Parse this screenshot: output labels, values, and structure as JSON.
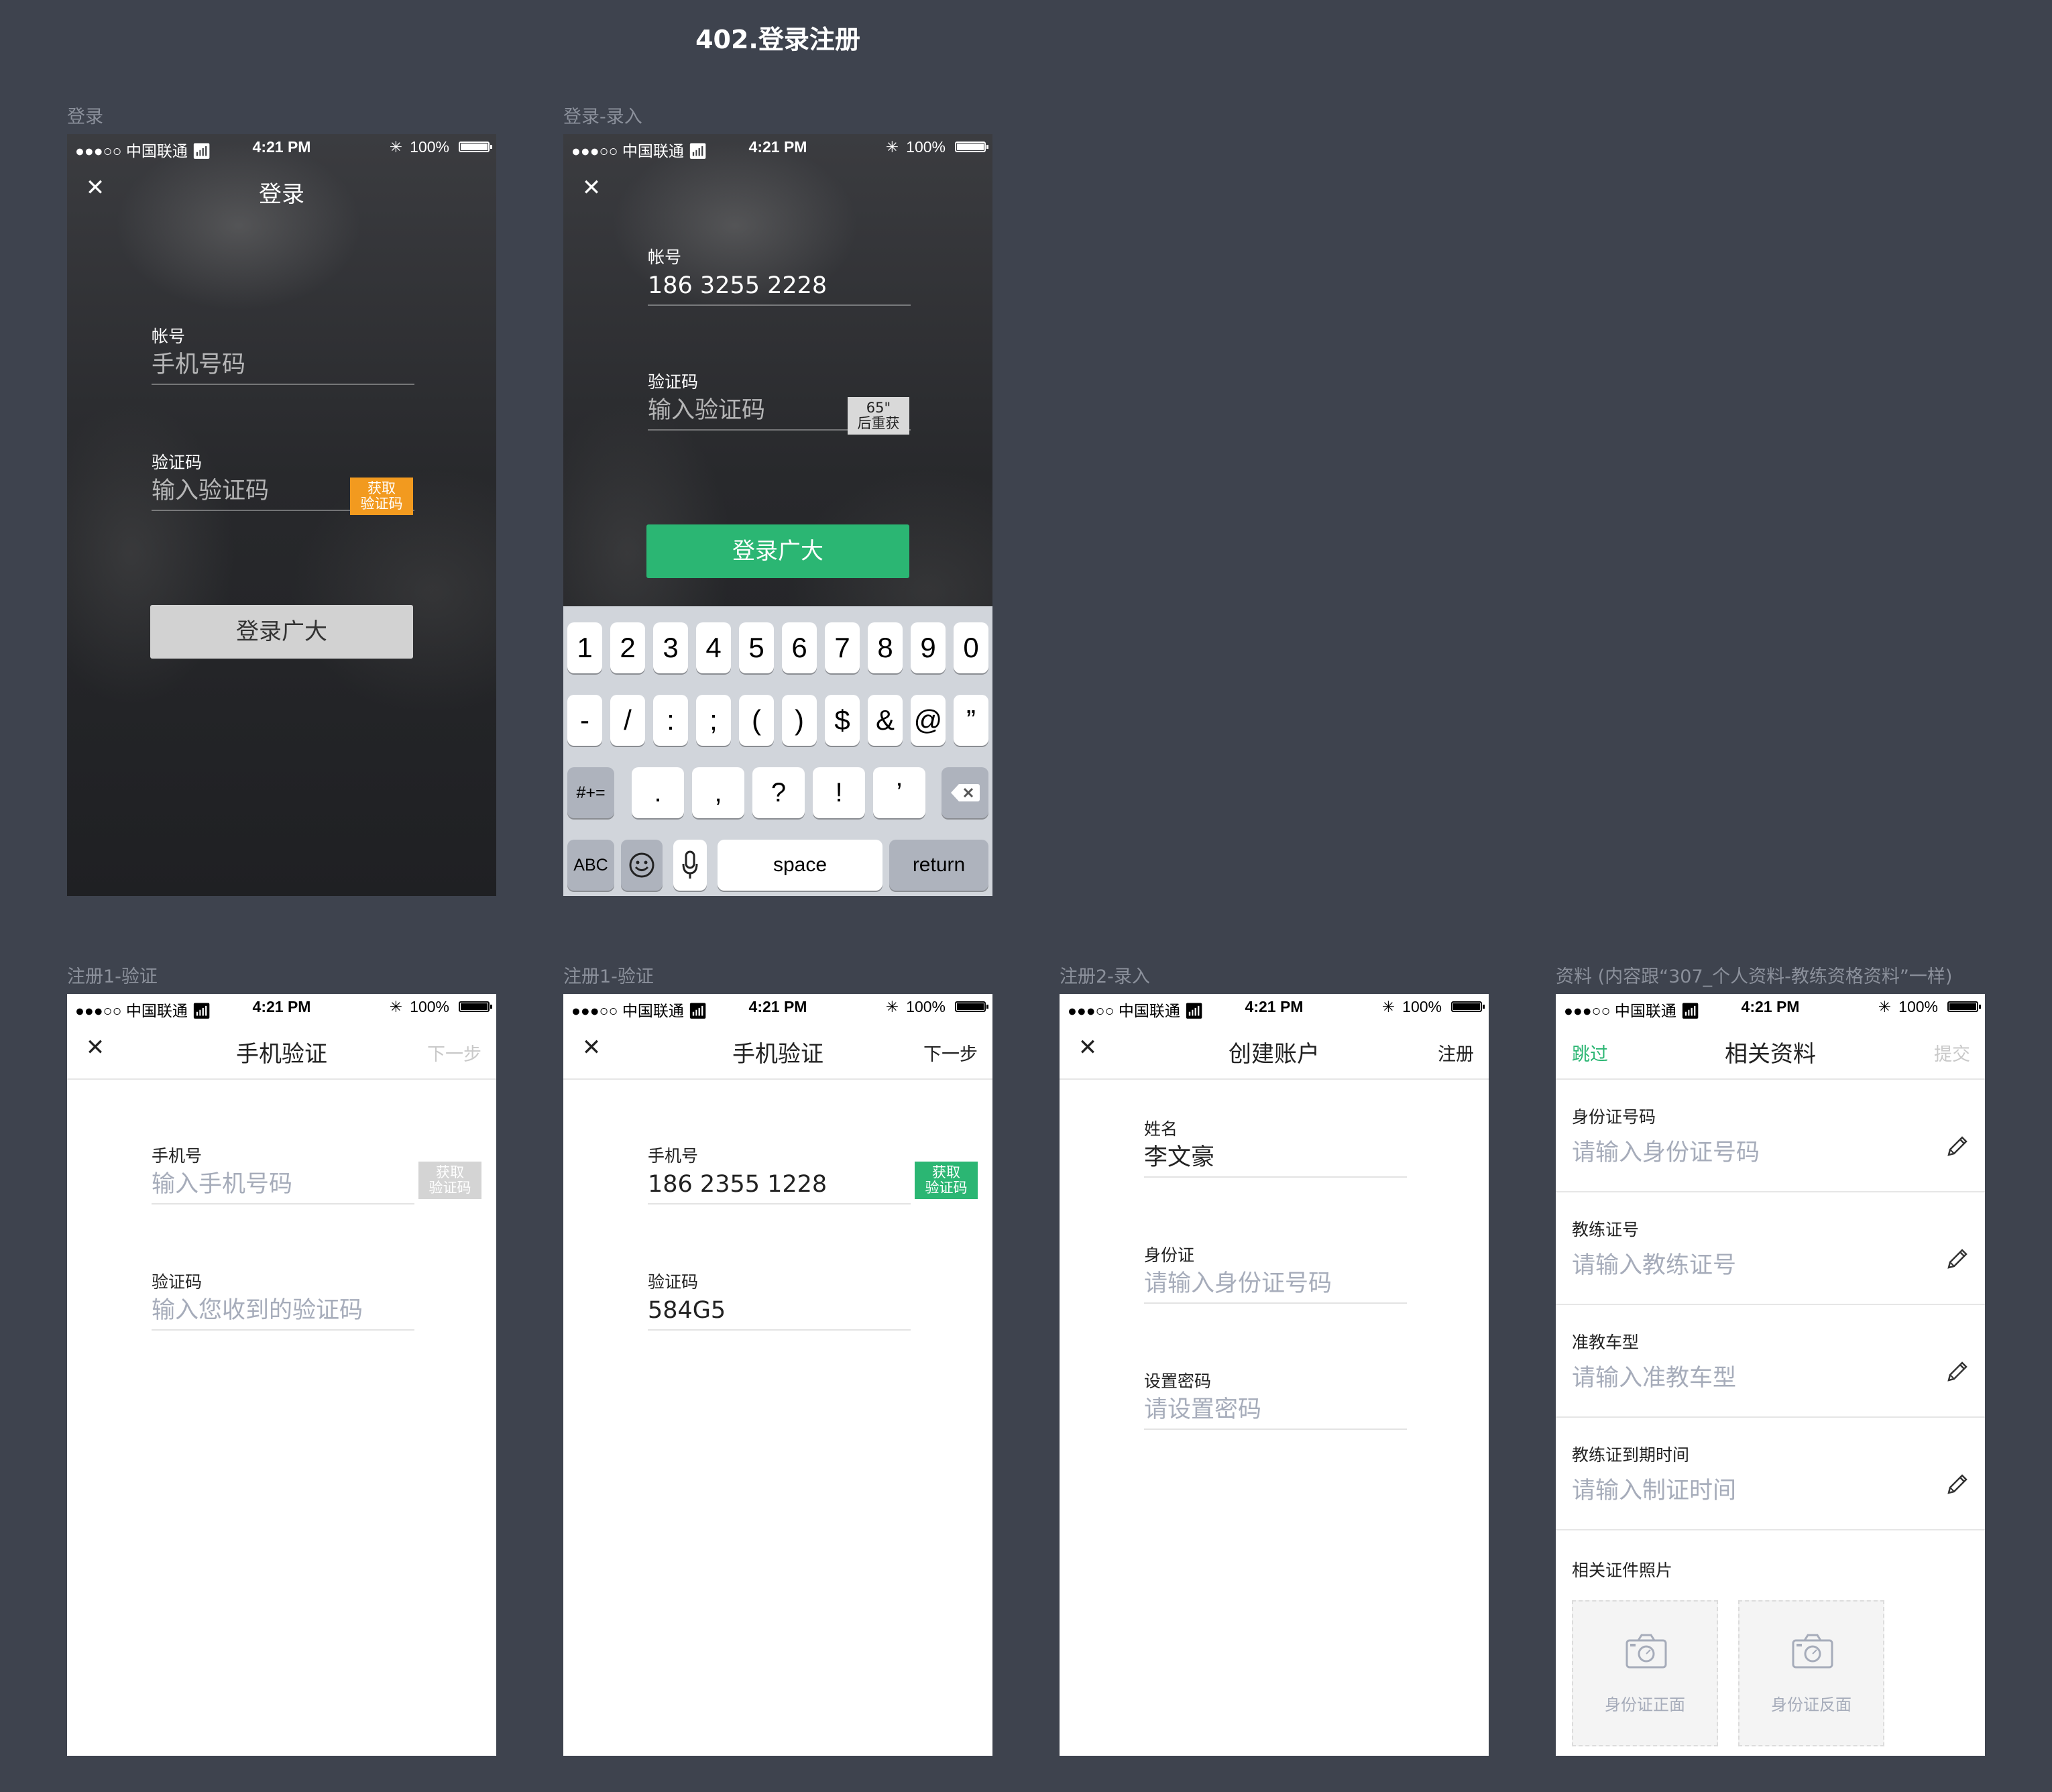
{
  "page_title": "402.登录注册",
  "status_bar": {
    "carrier": "●●●○○ 中国联通",
    "time": "4:21 PM",
    "battery": "100%"
  },
  "screens": {
    "login": {
      "label": "登录",
      "nav_title": "登录",
      "account_label": "帐号",
      "account_placeholder": "手机号码",
      "code_label": "验证码",
      "code_placeholder": "输入验证码",
      "get_code_line1": "获取",
      "get_code_line2": "验证码",
      "login_button": "登录广大"
    },
    "login_input": {
      "label": "登录-录入",
      "account_label": "帐号",
      "account_value": "186 3255 2228",
      "code_label": "验证码",
      "code_placeholder": "输入验证码",
      "countdown_line1": "65\"",
      "countdown_line2": "后重获",
      "login_button": "登录广大",
      "keyboard": {
        "row1": [
          "1",
          "2",
          "3",
          "4",
          "5",
          "6",
          "7",
          "8",
          "9",
          "0"
        ],
        "row2": [
          "-",
          "/",
          ":",
          ";",
          "(",
          ")",
          "$",
          "&",
          "@",
          "”"
        ],
        "row3": [
          ".",
          ",",
          "?",
          "!",
          "’"
        ],
        "sym_toggle": "#+=",
        "abc": "ABC",
        "space": "space",
        "return": "return"
      }
    },
    "register1_empty": {
      "label": "注册1-验证",
      "nav_title": "手机验证",
      "next": "下一步",
      "phone_label": "手机号",
      "phone_placeholder": "输入手机号码",
      "get_code_line1": "获取",
      "get_code_line2": "验证码",
      "code_label": "验证码",
      "code_placeholder": "输入您收到的验证码"
    },
    "register1_filled": {
      "label": "注册1-验证",
      "nav_title": "手机验证",
      "next": "下一步",
      "phone_label": "手机号",
      "phone_value": "186 2355 1228",
      "get_code_line1": "获取",
      "get_code_line2": "验证码",
      "code_label": "验证码",
      "code_value": "584G5"
    },
    "register2": {
      "label": "注册2-录入",
      "nav_title": "创建账户",
      "register": "注册",
      "name_label": "姓名",
      "name_value": "李文豪",
      "id_label": "身份证",
      "id_placeholder": "请输入身份证号码",
      "pwd_label": "设置密码",
      "pwd_placeholder": "请设置密码"
    },
    "profile": {
      "label": "资料 (内容跟“307_个人资料-教练资格资料”一样)",
      "skip": "跳过",
      "nav_title": "相关资料",
      "submit": "提交",
      "items": [
        {
          "label": "身份证号码",
          "placeholder": "请输入身份证号码"
        },
        {
          "label": "教练证号",
          "placeholder": "请输入教练证号"
        },
        {
          "label": "准教车型",
          "placeholder": "请输入准教车型"
        },
        {
          "label": "教练证到期时间",
          "placeholder": "请输入制证时间"
        }
      ],
      "photos_label": "相关证件照片",
      "photo_front": "身份证正面",
      "photo_back": "身份证反面"
    }
  },
  "colors": {
    "background": "#3e434e",
    "green": "#2bb673",
    "orange": "#f29a1f",
    "placeholder": "#a6acba"
  }
}
